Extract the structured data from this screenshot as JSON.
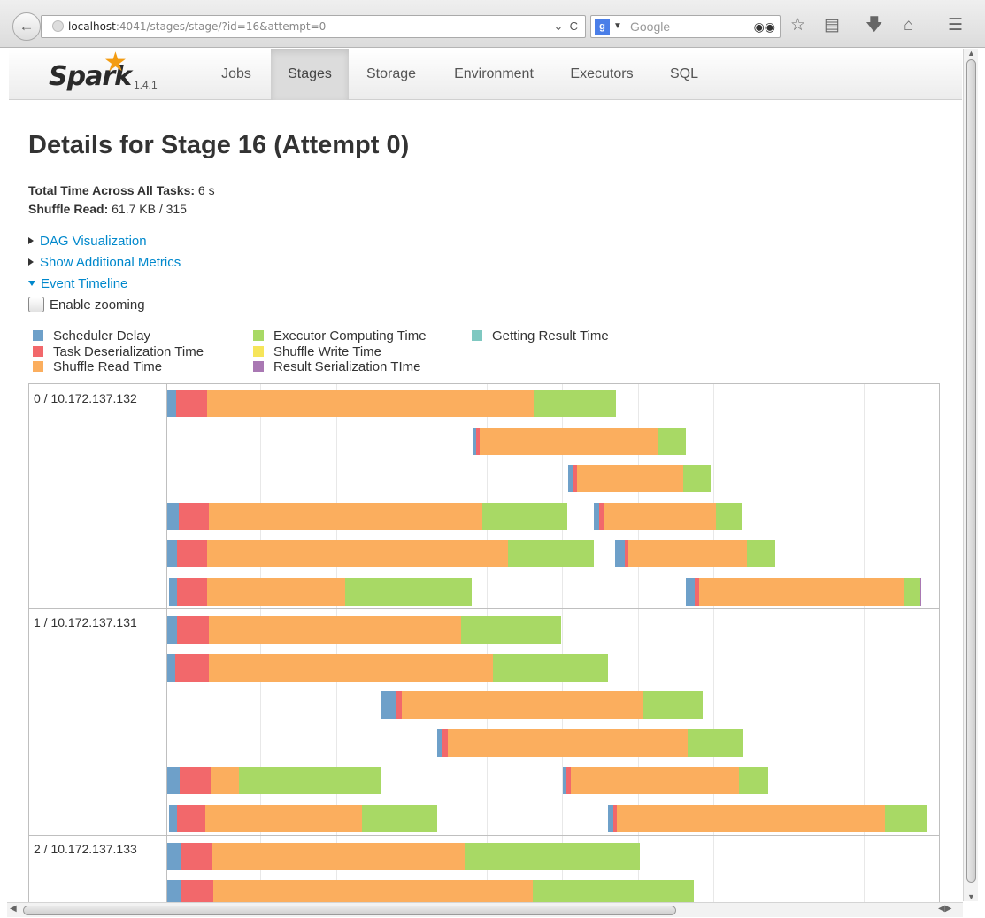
{
  "browser": {
    "url_host": "localhost",
    "url_path": ":4041/stages/stage/?id=16&attempt=0",
    "search_placeholder": "Google",
    "search_engine_glyph": "g",
    "dropdown_glyph": "⌄",
    "reload_glyph": "C"
  },
  "nav": {
    "logo_text": "Spark",
    "version": "1.4.1",
    "tabs": [
      {
        "label": "Jobs",
        "active": false
      },
      {
        "label": "Stages",
        "active": true
      },
      {
        "label": "Storage",
        "active": false
      },
      {
        "label": "Environment",
        "active": false
      },
      {
        "label": "Executors",
        "active": false
      },
      {
        "label": "SQL",
        "active": false
      }
    ]
  },
  "page": {
    "title": "Details for Stage 16 (Attempt 0)",
    "total_time_label": "Total Time Across All Tasks:",
    "total_time_value": "6 s",
    "shuffle_read_label": "Shuffle Read:",
    "shuffle_read_value": "61.7 KB / 315",
    "dag_link": "DAG Visualization",
    "metrics_link": "Show Additional Metrics",
    "timeline_link": "Event Timeline",
    "zoom_label": "Enable zooming"
  },
  "legend": [
    {
      "label": "Scheduler Delay",
      "color": "#6ea0c9"
    },
    {
      "label": "Task Deserialization Time",
      "color": "#f2686b"
    },
    {
      "label": "Shuffle Read Time",
      "color": "#fbae5e"
    },
    {
      "label": "Executor Computing Time",
      "color": "#a8d965"
    },
    {
      "label": "Shuffle Write Time",
      "color": "#f6e55a"
    },
    {
      "label": "Result Serialization TIme",
      "color": "#a978b3"
    },
    {
      "label": "Getting Result Time",
      "color": "#7fc8c1"
    }
  ],
  "executors": [
    {
      "label": "0 / 10.172.137.132"
    },
    {
      "label": "1 / 10.172.137.131"
    },
    {
      "label": "2 / 10.172.137.133"
    }
  ]
}
